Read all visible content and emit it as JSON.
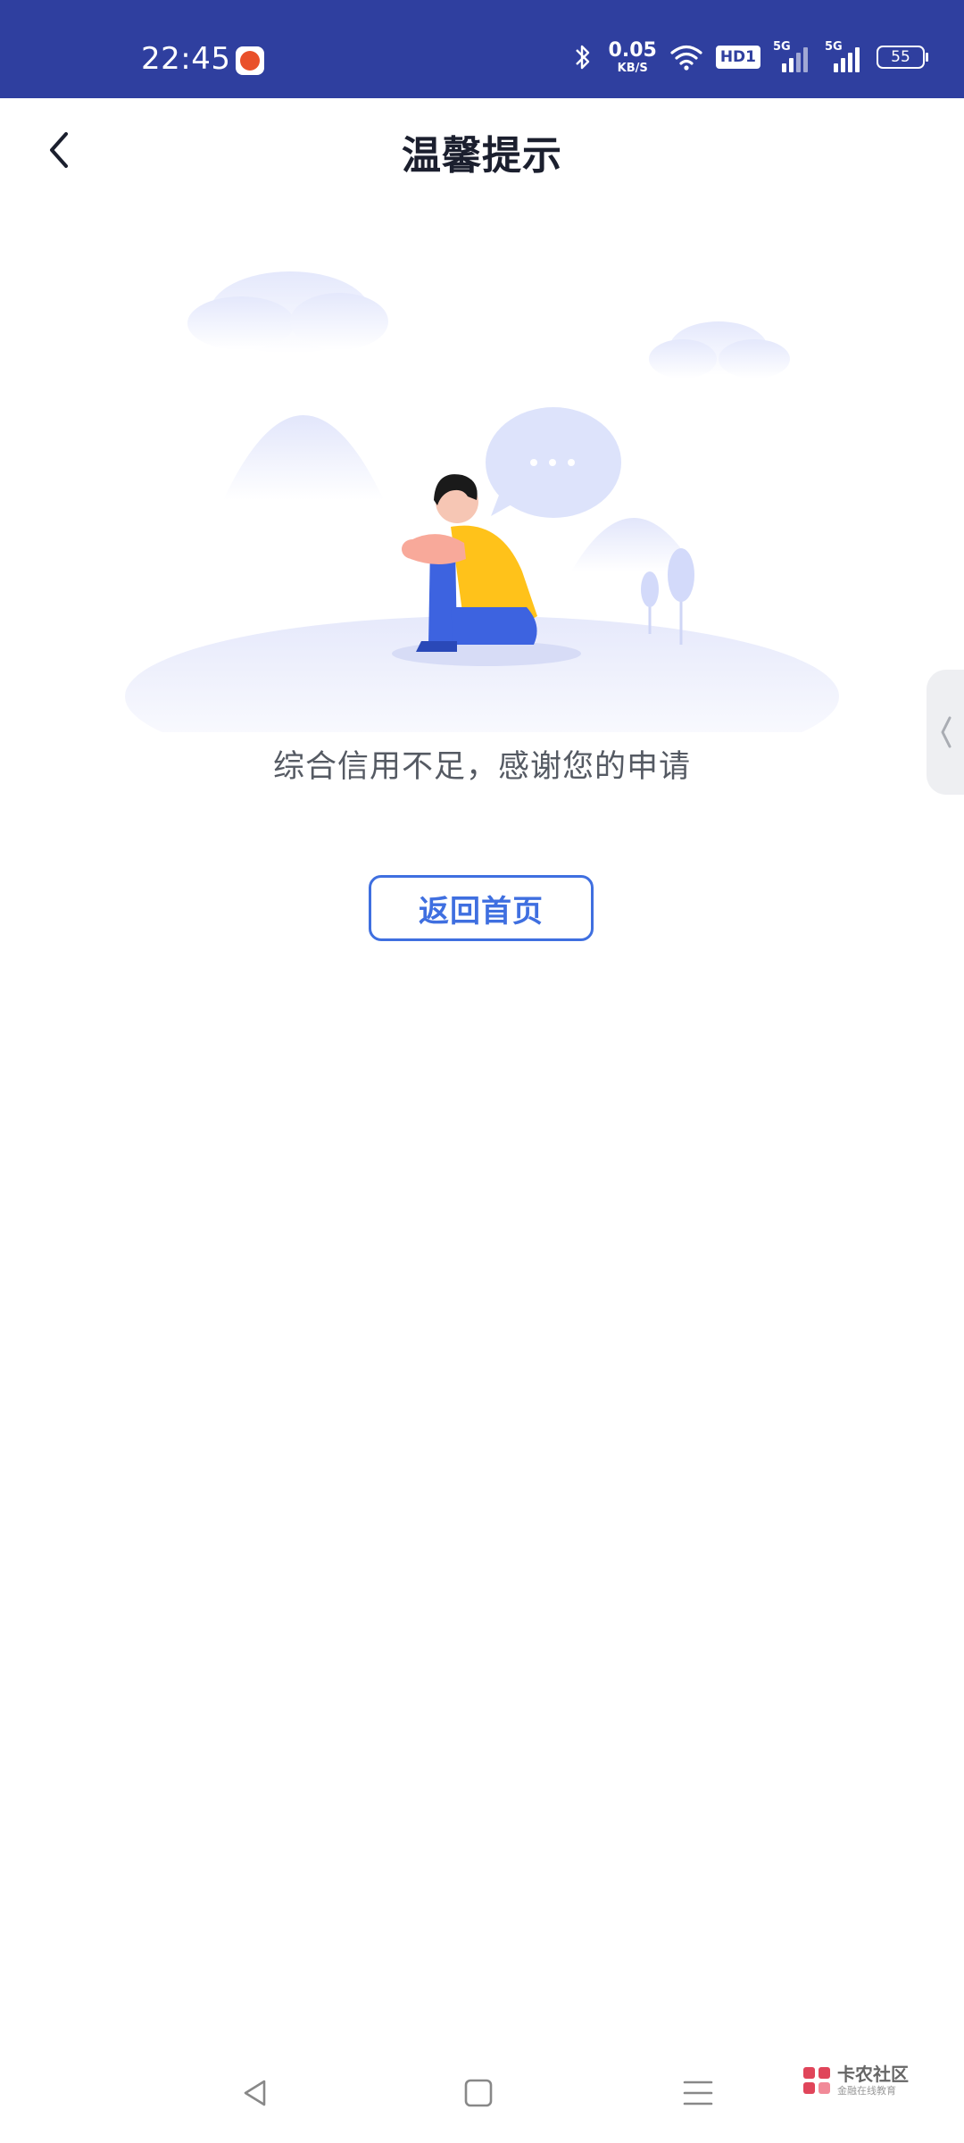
{
  "status_bar": {
    "time": "22:45",
    "net_speed_value": "0.05",
    "net_speed_unit": "KB/S",
    "hd_label": "HD1",
    "signal1_label": "5G",
    "signal2_label": "5G",
    "battery_level": "55"
  },
  "header": {
    "title": "温馨提示",
    "back_icon": "chevron-left-icon"
  },
  "main": {
    "message": "综合信用不足，感谢您的申请",
    "return_home_label": "返回首页",
    "accent_color": "#3f6fe0"
  },
  "navbar": {
    "back_icon": "triangle-back-icon",
    "home_icon": "square-home-icon",
    "menu_icon": "menu-lines-icon"
  },
  "watermark": {
    "title": "卡农社区",
    "subtitle": "金融在线教育"
  },
  "colors": {
    "status_bar_bg": "#2f3f9f",
    "title_text": "#1b1f2e",
    "message_text": "#555a63"
  }
}
